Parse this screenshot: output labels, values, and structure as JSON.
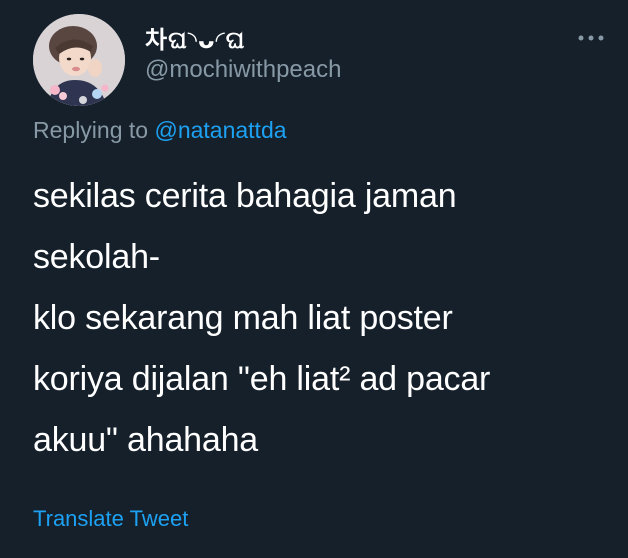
{
  "tweet": {
    "author": {
      "display_name": "차ଘ◝ᴗ◜ଘ",
      "handle": "@mochiwithpeach",
      "avatar_icon": "profile-photo"
    },
    "more_icon": "more-horizontal-icon",
    "reply_context": {
      "prefix": "Replying to",
      "mention": "@natanattda"
    },
    "text_lines": [
      "sekilas cerita bahagia jaman",
      "sekolah-",
      "klo sekarang mah liat poster",
      "koriya dijalan \"eh liat² ad pacar",
      "akuu\" ahahaha"
    ],
    "translate_label": "Translate Tweet"
  },
  "colors": {
    "background": "#15202b",
    "text_primary": "#ffffff",
    "text_secondary": "#8899a6",
    "link": "#1da1f2"
  }
}
